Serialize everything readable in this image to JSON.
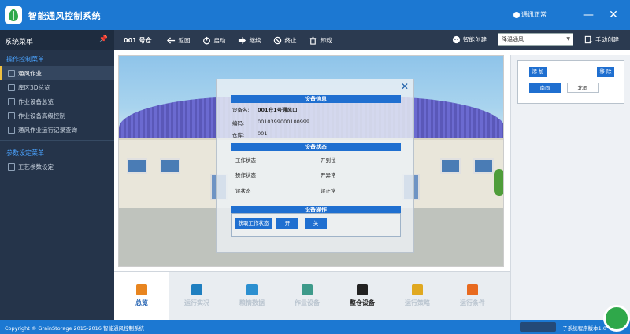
{
  "app": {
    "title": "智能通风控制系统",
    "status": "通讯正常"
  },
  "window_controls": {
    "minimize": "—",
    "close": "✕"
  },
  "sidebar": {
    "header": "系统菜单",
    "group1": "操作控制菜单",
    "items1": [
      "通风作业",
      "库区3D总览",
      "作业设备总览",
      "作业设备高级控制",
      "通风作业运行记录查询"
    ],
    "group2": "参数设定菜单",
    "items2": [
      "工艺参数设定"
    ]
  },
  "toolbar": {
    "warehouse": "001 号仓",
    "back": "返回",
    "start": "启动",
    "continue": "继续",
    "stop": "终止",
    "unload": "卸载",
    "smart_create": "智能创建",
    "mode_value": "降温通风",
    "manual_create": "手动创建"
  },
  "dialog": {
    "info_title": "设备信息",
    "device_name_label": "设备名:",
    "device_name": "001仓1号通风口",
    "code_label": "编码:",
    "code": "0010399000100999",
    "warehouse_label": "仓库:",
    "warehouse": "001",
    "status_title": "设备状态",
    "work_status": "工作状态",
    "open_pos": "开到位",
    "op_status": "操作状态",
    "open_abnormal": "开异常",
    "read_status": "读状态",
    "read_normal": "读正常",
    "ops_title": "设备操作",
    "get_status": "获取工作状态",
    "open": "开",
    "close_btn": "关"
  },
  "right_panel": {
    "add": "添 加",
    "remove": "移 除",
    "south": "南面",
    "north": "北面"
  },
  "bottom_nav": [
    "总览",
    "运行实况",
    "粮情数据",
    "作业设备",
    "整仓设备",
    "运行策略",
    "运行条件"
  ],
  "status_bar": {
    "copyright": "Copyright © GrainStorage 2015-2016 智能通风控制系统",
    "sub_version": "子系统程序版本1.0"
  },
  "colors": {
    "titlebar": "#1c78d2",
    "sidebar": "#25344a",
    "toolbar": "#2b3a50",
    "accent": "#1f6fd0",
    "active_marker": "#f0c040"
  }
}
